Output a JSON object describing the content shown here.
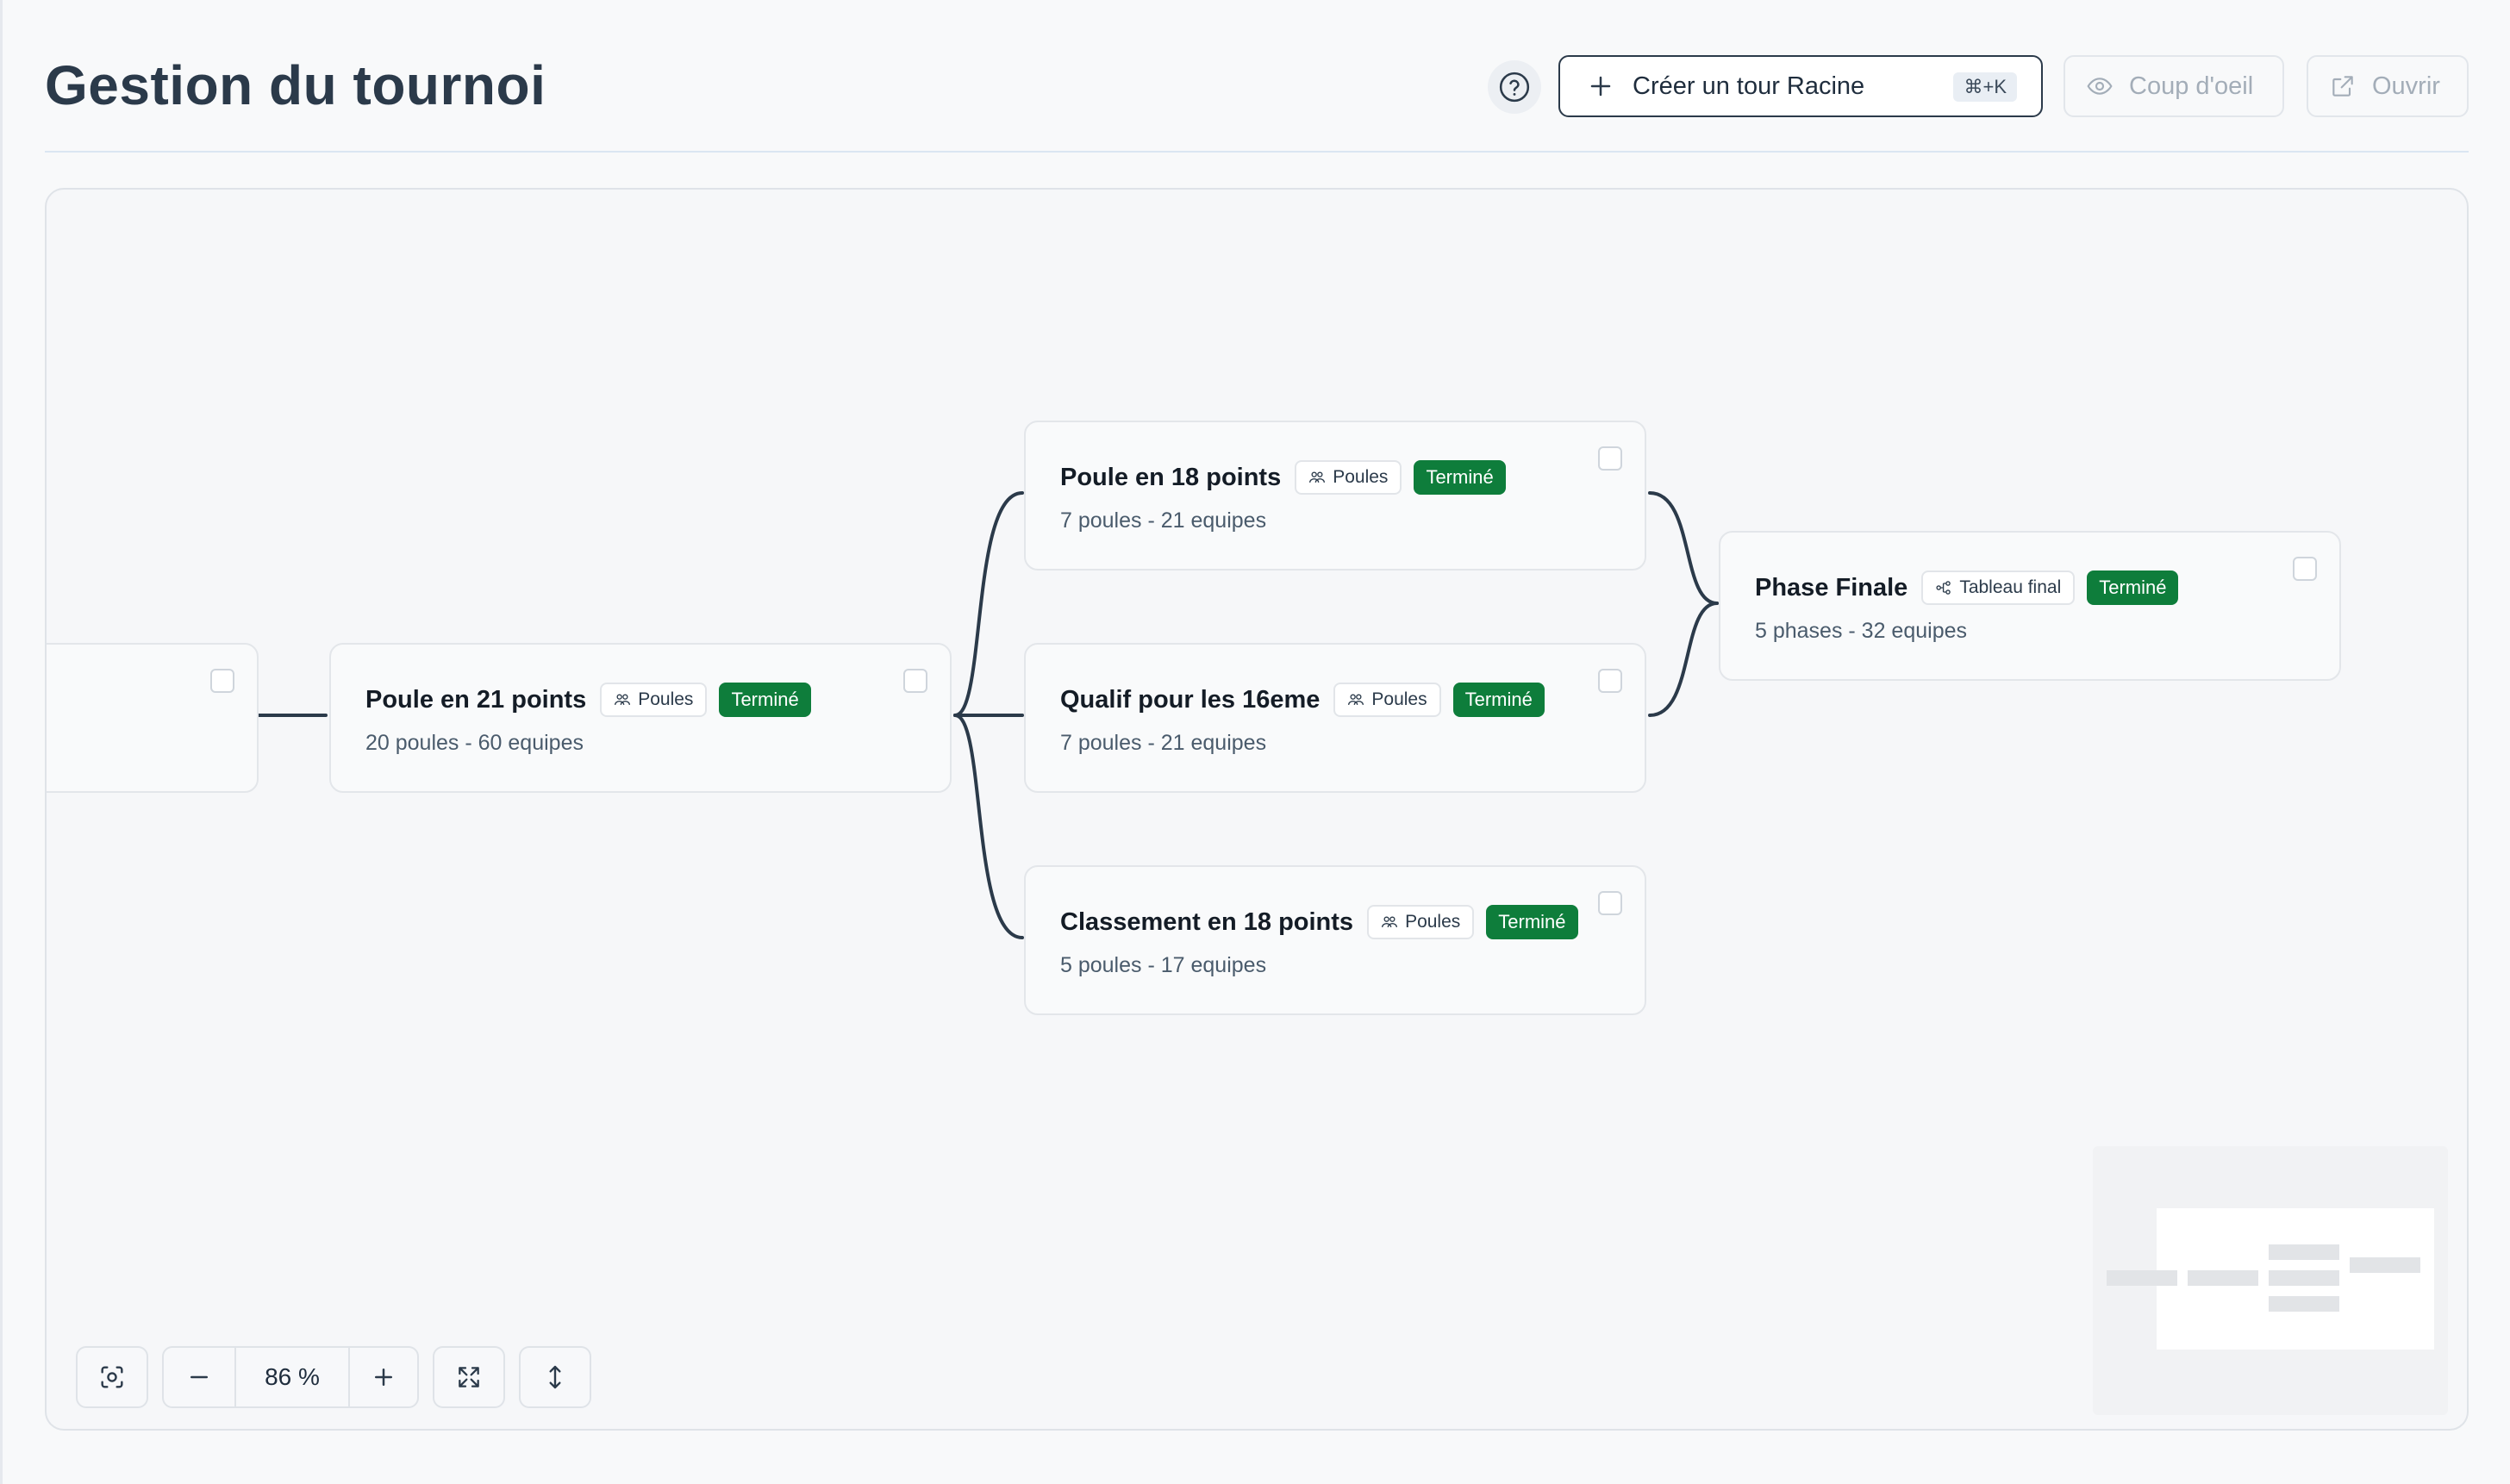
{
  "page": {
    "title": "Gestion du tournoi"
  },
  "header": {
    "help_icon": "question-circle-icon",
    "create_root_label": "Créer un tour Racine",
    "create_root_shortcut": "⌘+K",
    "preview_label": "Coup d'oeil",
    "open_label": "Ouvrir"
  },
  "colors": {
    "status_done": "#0e7d3b",
    "primary_border": "#2b3a4a",
    "connector": "#2b3a4a"
  },
  "tree": {
    "nodes": [
      {
        "id": "root",
        "title": "",
        "subtitle": ""
      },
      {
        "id": "poule-21",
        "title": "Poule en 21 points",
        "type_label": "Poules",
        "type_icon": "team-icon",
        "status": "Terminé",
        "subtitle": "20 poules - 60 equipes"
      },
      {
        "id": "poule-18",
        "title": "Poule en 18 points",
        "type_label": "Poules",
        "type_icon": "team-icon",
        "status": "Terminé",
        "subtitle": "7 poules - 21 equipes"
      },
      {
        "id": "qualif-16",
        "title": "Qualif pour les 16eme",
        "type_label": "Poules",
        "type_icon": "team-icon",
        "status": "Terminé",
        "subtitle": "7 poules - 21 equipes"
      },
      {
        "id": "classement-18",
        "title": "Classement en 18 points",
        "type_label": "Poules",
        "type_icon": "team-icon",
        "status": "Terminé",
        "subtitle": "5 poules - 17 equipes"
      },
      {
        "id": "phase-finale",
        "title": "Phase Finale",
        "type_label": "Tableau final",
        "type_icon": "bracket-icon",
        "status": "Terminé",
        "subtitle": "5 phases - 32 equipes"
      }
    ]
  },
  "controls": {
    "fit_icon": "focus-icon",
    "zoom_out_icon": "minus-icon",
    "zoom_level": "86 %",
    "zoom_in_icon": "plus-icon",
    "expand_icon": "expand-icon",
    "vertical_icon": "vertical-arrows-icon"
  }
}
